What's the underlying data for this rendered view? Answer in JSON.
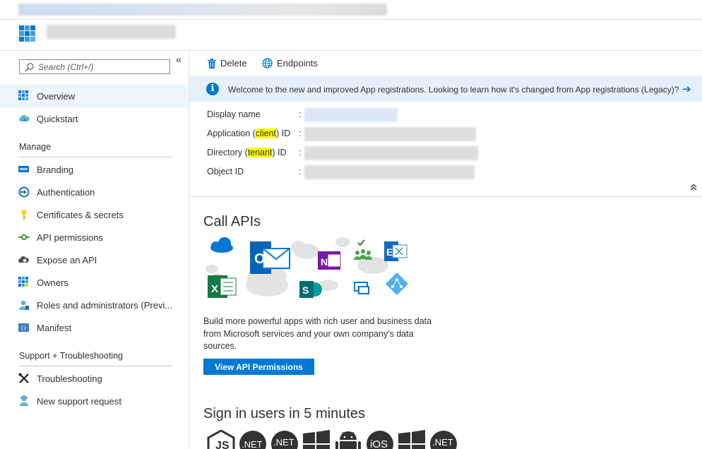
{
  "nav": {
    "search_placeholder": "Search (Ctrl+/)",
    "collapse_glyph": "«",
    "top_items": [
      {
        "label": "Overview",
        "icon": "overview-grid-icon",
        "selected": true
      },
      {
        "label": "Quickstart",
        "icon": "cloud-icon",
        "selected": false
      }
    ],
    "manage_header": "Manage",
    "manage_items": [
      {
        "label": "Branding",
        "icon": "branding-icon"
      },
      {
        "label": "Authentication",
        "icon": "authentication-icon"
      },
      {
        "label": "Certificates & secrets",
        "icon": "key-icon"
      },
      {
        "label": "API permissions",
        "icon": "api-permissions-icon"
      },
      {
        "label": "Expose an API",
        "icon": "cloud-gear-icon"
      },
      {
        "label": "Owners",
        "icon": "owners-grid-icon"
      },
      {
        "label": "Roles and administrators (Previ...",
        "icon": "user-roles-icon"
      },
      {
        "label": "Manifest",
        "icon": "manifest-icon"
      }
    ],
    "support_header": "Support + Troubleshooting",
    "support_items": [
      {
        "label": "Troubleshooting",
        "icon": "wrench-icon"
      },
      {
        "label": "New support request",
        "icon": "support-person-icon"
      }
    ]
  },
  "commands": {
    "delete_label": "Delete",
    "endpoints_label": "Endpoints"
  },
  "info_banner": {
    "text": "Welcome to the new and improved App registrations. Looking to learn how it's changed from App registrations (Legacy)?",
    "arrow": "➔"
  },
  "essentials": {
    "display_name": {
      "label": "Display name"
    },
    "app_id": {
      "pre": "Application (",
      "highlight": "client",
      "post": ") ID"
    },
    "dir_id": {
      "pre": "Directory (",
      "highlight": "tenant",
      "post": ") ID"
    },
    "object_id": {
      "label": "Object ID"
    },
    "colon": ":"
  },
  "call_apis": {
    "title": "Call APIs",
    "description": "Build more powerful apps with rich user and business data from Microsoft services and your own company's data sources.",
    "button_label": "View API Permissions"
  },
  "sign_in": {
    "title": "Sign in users in 5 minutes",
    "platforms": [
      ".NET",
      ".NET Core",
      "iOS"
    ]
  },
  "colors": {
    "accent": "#0078d4",
    "selected_bg": "#eef5fc",
    "banner_bg": "#e6f0fb",
    "highlight": "#ffff00"
  }
}
